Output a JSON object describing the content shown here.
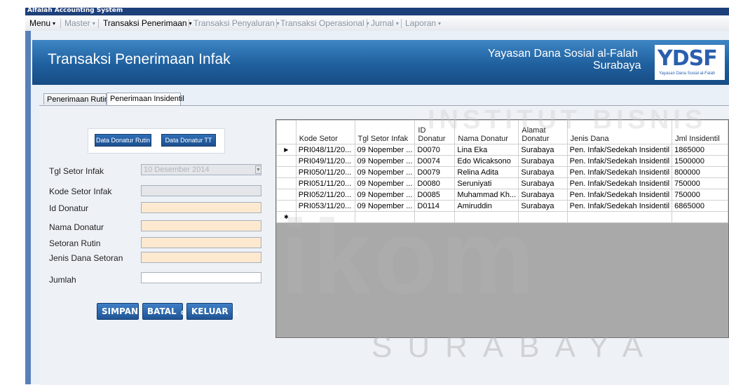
{
  "window": {
    "title": "Alfalah Accounting System"
  },
  "menu": [
    {
      "label": "Menu",
      "dim": false
    },
    {
      "label": "Master",
      "dim": true
    },
    {
      "label": "Transaksi Penerimaan",
      "dim": false
    },
    {
      "label": "Transaksi Penyaluran",
      "dim": true
    },
    {
      "label": "Transaksi Operasional",
      "dim": true
    },
    {
      "label": "Jurnal",
      "dim": true
    },
    {
      "label": "Laporan",
      "dim": true
    }
  ],
  "banner": {
    "title": "Transaksi Penerimaan Infak",
    "org_line1": "Yayasan Dana Sosial al-Falah",
    "org_line2": "Surabaya",
    "logo_text": "YDSF",
    "logo_sub": "Yayasan Dana Sosial al-Falah"
  },
  "tabs": [
    "Penerimaan Rutin",
    "Penerimaan Insidentil"
  ],
  "donor_buttons": [
    "Data Donatur Rutin",
    "Data Donatur TT"
  ],
  "form": {
    "tgl_label": "Tgl Setor Infak",
    "tgl_value": "10 Desember 2014",
    "kode_label": "Kode Setor Infak",
    "id_label": "Id Donatur",
    "nama_label": "Nama Donatur",
    "rutin_label": "Setoran Rutin",
    "jenis_label": "Jenis Dana Setoran",
    "jumlah_label": "Jumlah"
  },
  "actions": {
    "save": "SIMPAN",
    "cancel": "BATAL",
    "exit": "KELUAR"
  },
  "grid": {
    "columns": [
      "Kode Setor",
      "Tgl Setor Infak",
      "ID Donatur",
      "Nama Donatur",
      "Alamat Donatur",
      "Jenis Dana",
      "Jml Insidentil"
    ],
    "rows": [
      [
        "PRI048/11/20...",
        "09 Nopember ...",
        "D0070",
        "Lina Eka",
        "Surabaya",
        "Pen. Infak/Sedekah Insidentil",
        "1865000"
      ],
      [
        "PRI049/11/20...",
        "09 Nopember ...",
        "D0074",
        "Edo Wicaksono",
        "Surabaya",
        "Pen. Infak/Sedekah Insidentil",
        "1500000"
      ],
      [
        "PRI050/11/20...",
        "09 Nopember ...",
        "D0079",
        "Relina Adita",
        "Surabaya",
        "Pen. Infak/Sedekah Insidentil",
        "800000"
      ],
      [
        "PRI051/11/20...",
        "09 Nopember ...",
        "D0080",
        "Seruniyati",
        "Surabaya",
        "Pen. Infak/Sedekah Insidentil",
        "750000"
      ],
      [
        "PRI052/11/20...",
        "09 Nopember ...",
        "D0085",
        "Muhammad Kh...",
        "Surabaya",
        "Pen. Infak/Sedekah Insidentil",
        "750000"
      ],
      [
        "PRI053/11/20...",
        "09 Nopember ...",
        "D0114",
        "Amiruddin",
        "Surabaya",
        "Pen. Infak/Sedekah Insidentil",
        "6865000"
      ]
    ]
  },
  "watermark": {
    "top": "INSTITUT BISNIS",
    "mid": "ikom",
    "bottom": "SURABAYA"
  },
  "colors": {
    "banner": "#1f5f9e",
    "button": "#1f5595",
    "peach_field": "#fde9cf"
  }
}
